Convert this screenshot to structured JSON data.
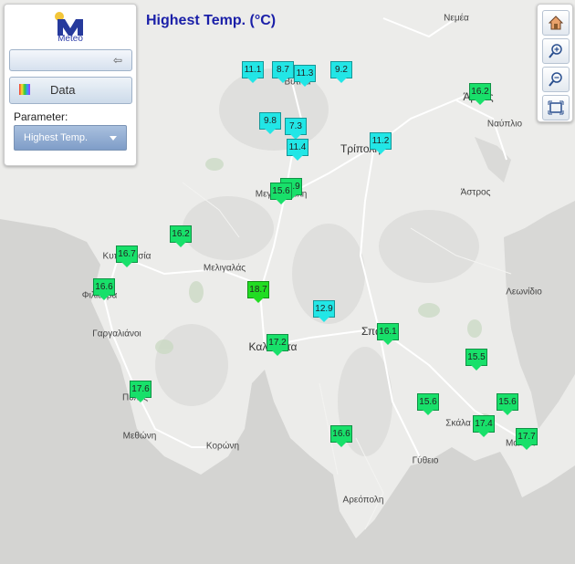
{
  "title": "Highest Temp. (°C)",
  "panel": {
    "logo_text": "Meteo",
    "data_button": "Data",
    "parameter_label": "Parameter:",
    "parameter_value": "Highest Temp."
  },
  "places": [
    {
      "name": "Νεμέα"
    },
    {
      "name": "Βυτίνα"
    },
    {
      "name": "Άργος",
      "big": true
    },
    {
      "name": "Ναύπλιο"
    },
    {
      "name": "Τρίπολη",
      "big": true
    },
    {
      "name": "Μεγαλόπολη"
    },
    {
      "name": "Άστρος"
    },
    {
      "name": "Κυπαρισσία"
    },
    {
      "name": "Φιλιατρά"
    },
    {
      "name": "Μελιγαλάς"
    },
    {
      "name": "Λεωνίδιο"
    },
    {
      "name": "Σπάρτη",
      "big": true
    },
    {
      "name": "Γαργαλιάνοι"
    },
    {
      "name": "Καλαμάτα",
      "big": true
    },
    {
      "name": "Πύλος"
    },
    {
      "name": "Σκάλα"
    },
    {
      "name": "Μεθώνη"
    },
    {
      "name": "Κορώνη"
    },
    {
      "name": "Μολάοι"
    },
    {
      "name": "Γύθειο"
    },
    {
      "name": "Αρεόπολη"
    }
  ],
  "stations": [
    {
      "value": "11.1",
      "color": "#22e6e6"
    },
    {
      "value": "8.7",
      "color": "#22e6e6"
    },
    {
      "value": "11.3",
      "color": "#22e6e6"
    },
    {
      "value": "9.2",
      "color": "#22e6e6"
    },
    {
      "value": "16.2",
      "color": "#18e06a"
    },
    {
      "value": "9.8",
      "color": "#22e6e6"
    },
    {
      "value": "7.3",
      "color": "#22e6e6"
    },
    {
      "value": "11.4",
      "color": "#22e6e6"
    },
    {
      "value": "11.2",
      "color": "#22e6e6"
    },
    {
      "value": "15.9",
      "color": "#18e06a"
    },
    {
      "value": "15.6",
      "color": "#18e06a"
    },
    {
      "value": "16.2",
      "color": "#18e06a"
    },
    {
      "value": "16.7",
      "color": "#18e06a"
    },
    {
      "value": "16.6",
      "color": "#18e06a"
    },
    {
      "value": "18.7",
      "color": "#22dd22"
    },
    {
      "value": "12.9",
      "color": "#22e6e6"
    },
    {
      "value": "16.1",
      "color": "#18e06a"
    },
    {
      "value": "17.2",
      "color": "#18e06a"
    },
    {
      "value": "15.5",
      "color": "#18e06a"
    },
    {
      "value": "17.6",
      "color": "#18e06a"
    },
    {
      "value": "15.6",
      "color": "#18e06a"
    },
    {
      "value": "15.6",
      "color": "#18e06a"
    },
    {
      "value": "17.4",
      "color": "#18e06a"
    },
    {
      "value": "16.6",
      "color": "#18e06a"
    },
    {
      "value": "17.7",
      "color": "#18e06a"
    }
  ],
  "zoom_buttons": [
    {
      "icon": "home-icon"
    },
    {
      "icon": "zoom-in-icon"
    },
    {
      "icon": "zoom-out-icon"
    },
    {
      "icon": "fit-extent-icon"
    }
  ]
}
